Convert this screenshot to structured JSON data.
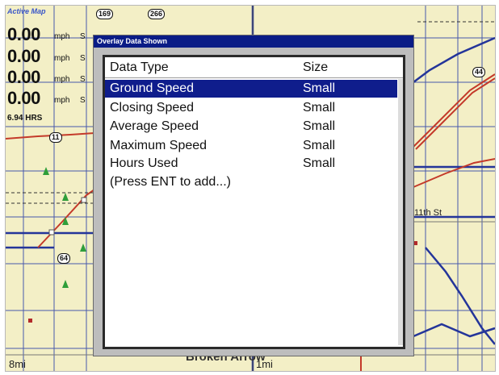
{
  "map": {
    "title": "Active Map",
    "overlays": [
      {
        "value": "0.00",
        "unit": "mph",
        "size": "S"
      },
      {
        "value": "0.00",
        "unit": "mph",
        "size": "S"
      },
      {
        "value": "0.00",
        "unit": "mph",
        "size": "S"
      },
      {
        "value": "0.00",
        "unit": "mph",
        "size": "S"
      }
    ],
    "hours": "6.94 HRS",
    "scale_left": "8mi",
    "scale_right": "1mi",
    "road_label": "11th St",
    "town_label": "Broken Arrow",
    "shields": [
      "169",
      "266",
      "11",
      "64",
      "44"
    ]
  },
  "dialog": {
    "title": "Overlay Data Shown",
    "col_type": "Data Type",
    "col_size": "Size",
    "rows": [
      {
        "label": "Ground Speed",
        "size": "Small"
      },
      {
        "label": "Closing Speed",
        "size": "Small"
      },
      {
        "label": "Average Speed",
        "size": "Small"
      },
      {
        "label": "Maximum Speed",
        "size": "Small"
      },
      {
        "label": "Hours Used",
        "size": "Small"
      }
    ],
    "hint": "(Press ENT to add...)"
  },
  "colors": {
    "map_bg": "#f3efc6",
    "highlight": "#0f1d8c",
    "titlebar": "#0a1c86",
    "road_blue": "#2a3fa8",
    "road_red": "#c43a2a"
  }
}
